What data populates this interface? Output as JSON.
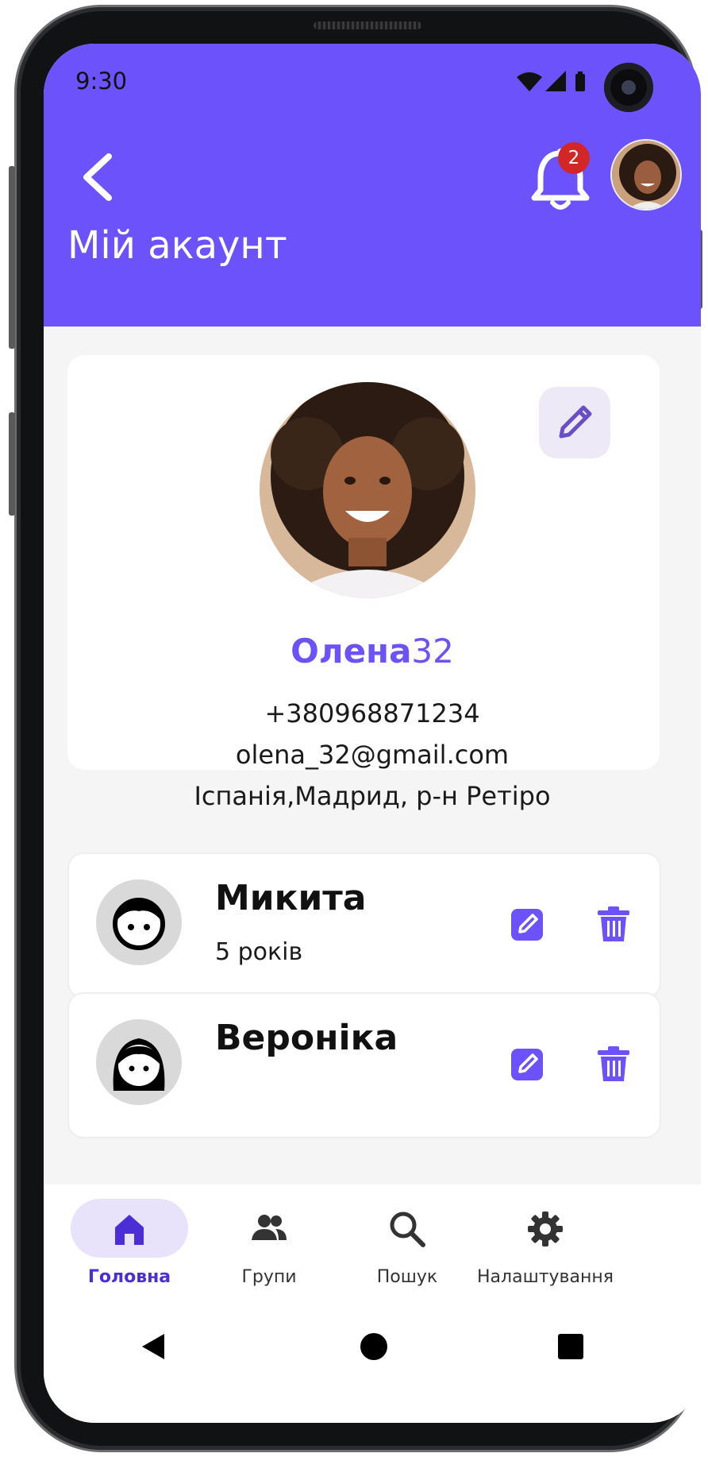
{
  "status_bar": {
    "time": "9:30"
  },
  "header": {
    "title": "Мій акаунт",
    "notification_count": "2"
  },
  "profile": {
    "name_main": "Олена",
    "name_suffix": "32",
    "phone": "+380968871234",
    "email": "olena_32@gmail.com",
    "address": "Іспанія,Мадрид, р-н Ретіро"
  },
  "children": [
    {
      "name": "Микита",
      "age": "5 років",
      "avatar": "boy-face-icon"
    },
    {
      "name": "Вероніка",
      "avatar": "girl-face-icon"
    }
  ],
  "bottom_nav": {
    "items": [
      {
        "label": "Головна",
        "icon": "home-icon",
        "active": true
      },
      {
        "label": "Групи",
        "icon": "groups-icon",
        "active": false
      },
      {
        "label": "Пошук",
        "icon": "search-icon",
        "active": false
      },
      {
        "label": "Налаштування",
        "icon": "settings-gear-icon",
        "active": false
      }
    ]
  },
  "colors": {
    "accent": "#6c52fb",
    "header_bg": "#6c52fb",
    "badge": "#d32626",
    "nav_active_pill": "#e8e2fb",
    "page_bg": "#f5f5f5"
  }
}
